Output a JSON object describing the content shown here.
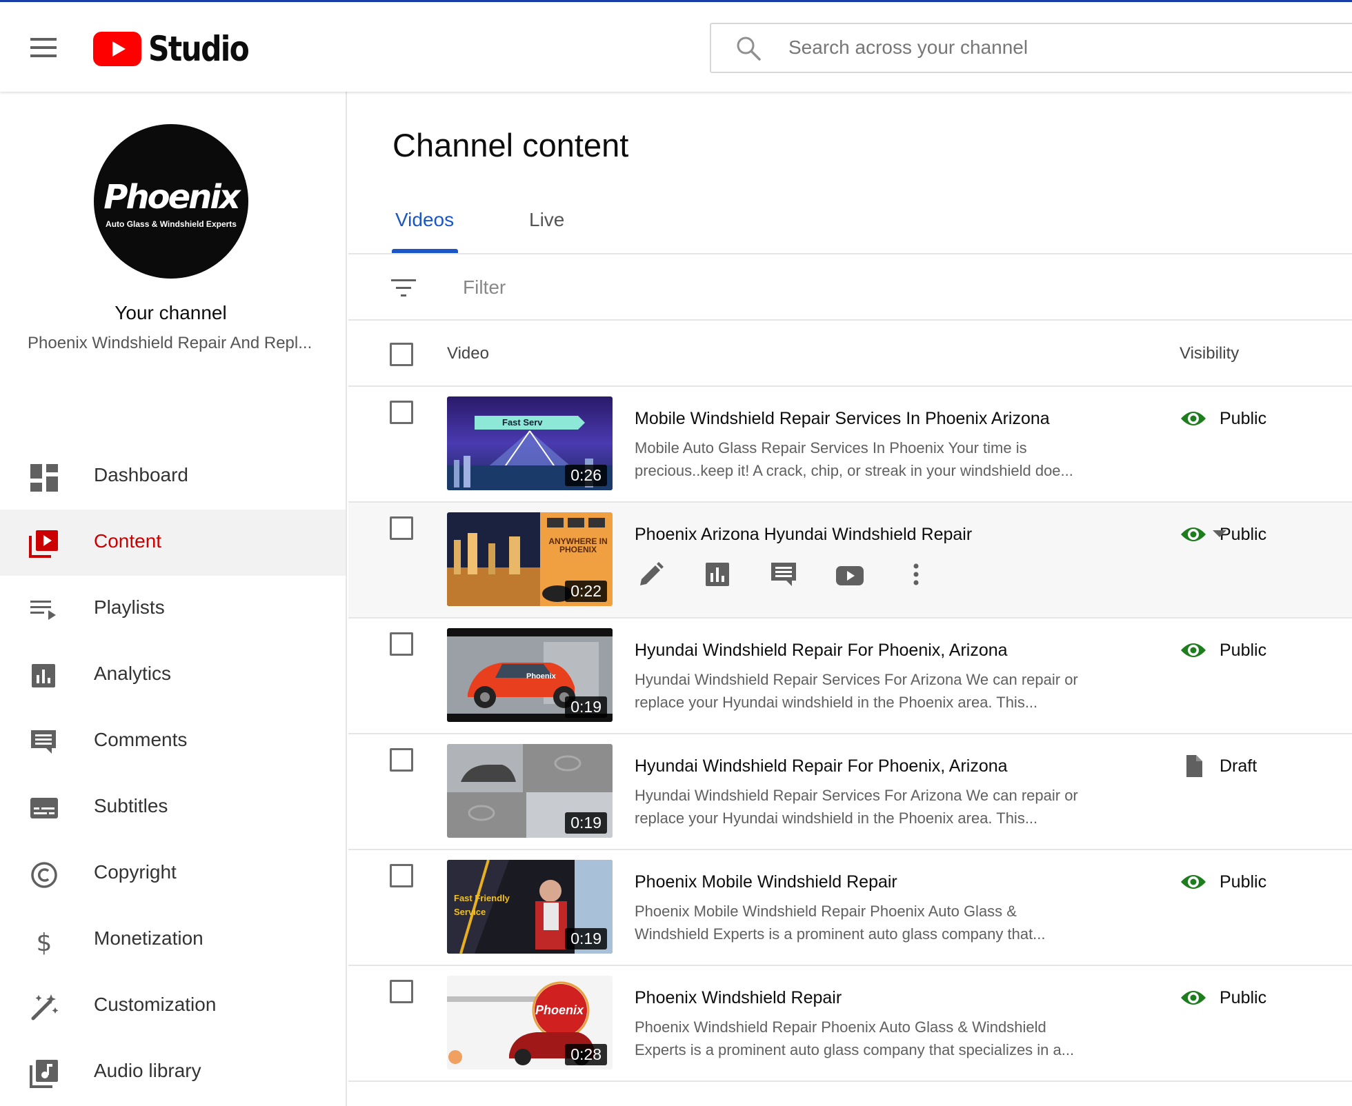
{
  "app": {
    "brand": "Studio",
    "accent_color": "#cc0000",
    "link_color": "#1a56c4"
  },
  "search": {
    "placeholder": "Search across your channel"
  },
  "channel": {
    "your_channel_label": "Your channel",
    "name": "Phoenix Windshield Repair And Repl...",
    "avatar_brand": "Phoenix",
    "avatar_tagline": "Auto Glass & Windshield Experts"
  },
  "sidebar": {
    "items": [
      {
        "label": "Dashboard",
        "icon": "dashboard-icon"
      },
      {
        "label": "Content",
        "icon": "content-icon",
        "active": true
      },
      {
        "label": "Playlists",
        "icon": "playlists-icon"
      },
      {
        "label": "Analytics",
        "icon": "analytics-icon"
      },
      {
        "label": "Comments",
        "icon": "comments-icon"
      },
      {
        "label": "Subtitles",
        "icon": "subtitles-icon"
      },
      {
        "label": "Copyright",
        "icon": "copyright-icon"
      },
      {
        "label": "Monetization",
        "icon": "monetization-icon"
      },
      {
        "label": "Customization",
        "icon": "customization-icon"
      },
      {
        "label": "Audio library",
        "icon": "audio-library-icon"
      }
    ]
  },
  "main": {
    "title": "Channel content",
    "tabs": [
      {
        "label": "Videos",
        "active": true
      },
      {
        "label": "Live"
      }
    ],
    "filter_placeholder": "Filter",
    "columns": {
      "video": "Video",
      "visibility": "Visibility"
    },
    "videos": [
      {
        "title": "Mobile Windshield Repair Services In Phoenix Arizona",
        "desc1": "Mobile Auto Glass Repair Services In Phoenix Your time is",
        "desc2": "precious..keep it! A crack, chip, or streak in your windshield doe...",
        "duration": "0:26",
        "visibility": "Public",
        "thumb_text": "Fast Serv"
      },
      {
        "title": "Phoenix Arizona Hyundai Windshield Repair",
        "desc1": "",
        "desc2": "",
        "duration": "0:22",
        "visibility": "Public",
        "thumb_text": "ANYWHERE IN PHOENIX"
      },
      {
        "title": "Hyundai Windshield Repair For Phoenix, Arizona",
        "desc1": "Hyundai Windshield Repair Services For Arizona We can repair or",
        "desc2": "replace your Hyundai windshield in the Phoenix area. This...",
        "duration": "0:19",
        "visibility": "Public",
        "thumb_text": "Phoenix"
      },
      {
        "title": "Hyundai Windshield Repair For Phoenix, Arizona",
        "desc1": "Hyundai Windshield Repair Services For Arizona We can repair or",
        "desc2": "replace your Hyundai windshield in the Phoenix area. This...",
        "duration": "0:19",
        "visibility": "Draft",
        "thumb_text": ""
      },
      {
        "title": "Phoenix Mobile Windshield Repair",
        "desc1": "Phoenix Mobile Windshield Repair Phoenix Auto Glass &",
        "desc2": "Windshield Experts is a prominent auto glass company that...",
        "duration": "0:19",
        "visibility": "Public",
        "thumb_text": "Fast Friendly Service"
      },
      {
        "title": "Phoenix Windshield Repair",
        "desc1": "Phoenix Windshield Repair Phoenix Auto Glass & Windshield",
        "desc2": "Experts is a prominent auto glass company that specializes in a...",
        "duration": "0:28",
        "visibility": "Public",
        "thumb_text": "Phoenix"
      }
    ]
  }
}
